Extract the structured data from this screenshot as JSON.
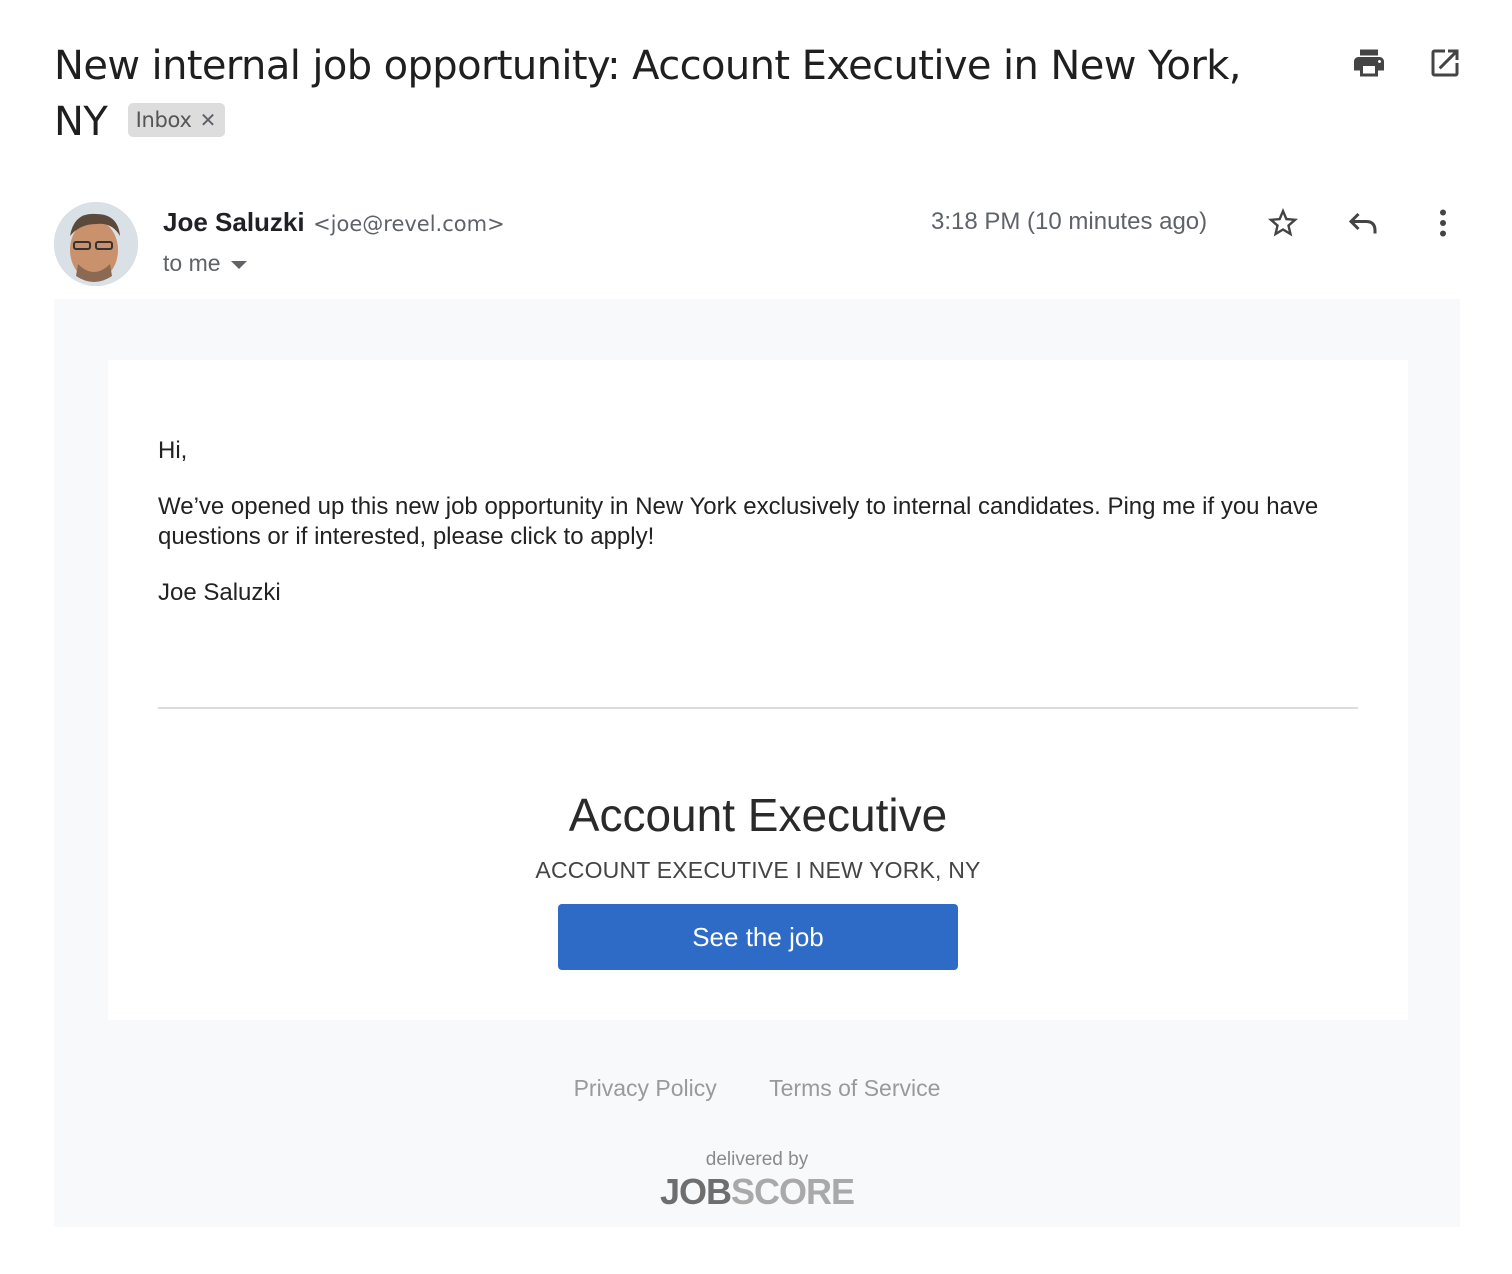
{
  "email": {
    "subject": "New internal job opportunity: Account Executive in New York, NY",
    "labels": [
      {
        "name": "Inbox",
        "remove_icon": "close-icon"
      }
    ],
    "toolbar": {
      "print_icon": "print-icon",
      "popout_icon": "open-in-new-window-icon"
    },
    "sender": {
      "name": "Joe Saluzki",
      "email": "<joe@revel.com>",
      "recipient_label": "to me",
      "avatar": "sender-avatar-photo"
    },
    "timestamp": "3:18 PM (10 minutes ago)",
    "actions": {
      "star_icon": "star-outline-icon",
      "reply_icon": "reply-icon",
      "more_icon": "more-vertical-icon"
    },
    "body": {
      "greeting": "Hi,",
      "paragraph": "We’ve opened up this new job opportunity in New York exclusively to internal candidates. Ping me if you have questions or if interested, please click to apply!",
      "signature": "Joe Saluzki"
    },
    "job": {
      "title": "Account Executive",
      "subtitle": "ACCOUNT EXECUTIVE I NEW YORK, NY",
      "cta_label": "See the job",
      "cta_color": "#2d6bc7"
    },
    "footer": {
      "links": [
        "Privacy Policy",
        "Terms of Service"
      ],
      "delivered_by": "delivered by",
      "brand_part1": "JOB",
      "brand_part2": "SCORE"
    }
  }
}
